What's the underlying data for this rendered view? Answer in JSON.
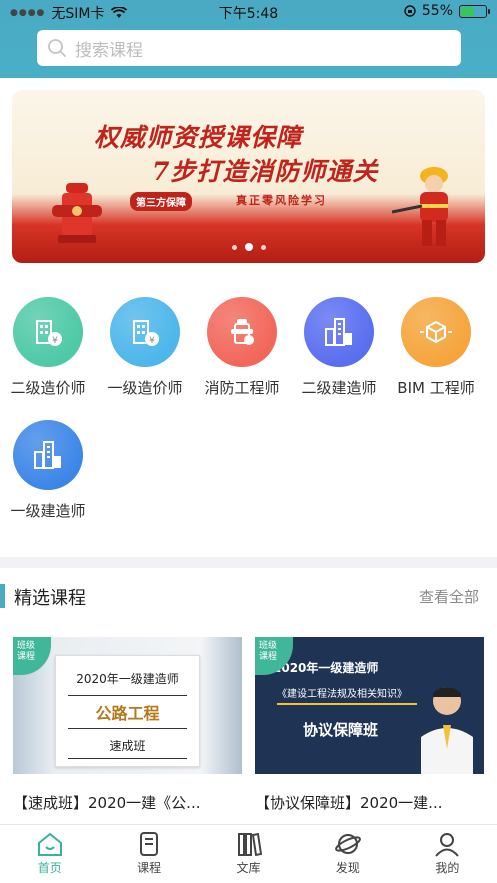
{
  "status_bar": {
    "carrier": "无SIM卡",
    "time": "下午5:48",
    "battery": "55%",
    "battery_level": 0.55
  },
  "search": {
    "placeholder": "搜索课程"
  },
  "banner": {
    "line1": "权威师资授课保障",
    "line2": "7步打造消防师通关",
    "badge": "第三方保障",
    "slogan": "真正零风险学习",
    "slides": 3,
    "active_slide": 1
  },
  "categories": [
    {
      "label": "二级造价师",
      "icon": "building-coin-icon",
      "color": "#4ec9a6"
    },
    {
      "label": "一级造价师",
      "icon": "building-coin-icon",
      "color": "#4db6ea"
    },
    {
      "label": "消防工程师",
      "icon": "hydrant-icon",
      "color": "#f2675a"
    },
    {
      "label": "二级建造师",
      "icon": "city-buildings-icon",
      "color": "#5a6ef0"
    },
    {
      "label": "BIM 工程师",
      "icon": "cube-icon",
      "color": "#f5a53c"
    },
    {
      "label": "一级建造师",
      "icon": "city-buildings-icon",
      "color": "#3d86e8"
    }
  ],
  "featured": {
    "title": "精选课程",
    "more": "查看全部",
    "courses": [
      {
        "tag_line1": "班级",
        "tag_line2": "课程",
        "cover_year": "2020年一级建造师",
        "cover_subject": "公路工程",
        "cover_class": "速成班",
        "title": "【速成班】2020一建《公..."
      },
      {
        "tag_line1": "班级",
        "tag_line2": "课程",
        "cover_year": "2020年一级建造师",
        "cover_subject": "《建设工程法规及相关知识》",
        "cover_class": "协议保障班",
        "title": "【协议保障班】2020一建..."
      }
    ]
  },
  "tabbar": [
    {
      "label": "首页",
      "icon": "home-icon",
      "active": true
    },
    {
      "label": "课程",
      "icon": "course-icon",
      "active": false
    },
    {
      "label": "文库",
      "icon": "library-icon",
      "active": false
    },
    {
      "label": "发现",
      "icon": "planet-icon",
      "active": false
    },
    {
      "label": "我的",
      "icon": "profile-icon",
      "active": false
    }
  ],
  "colors": {
    "header": "#4aa9c4",
    "accent": "#3bb09a",
    "banner_red": "#c0231a"
  }
}
